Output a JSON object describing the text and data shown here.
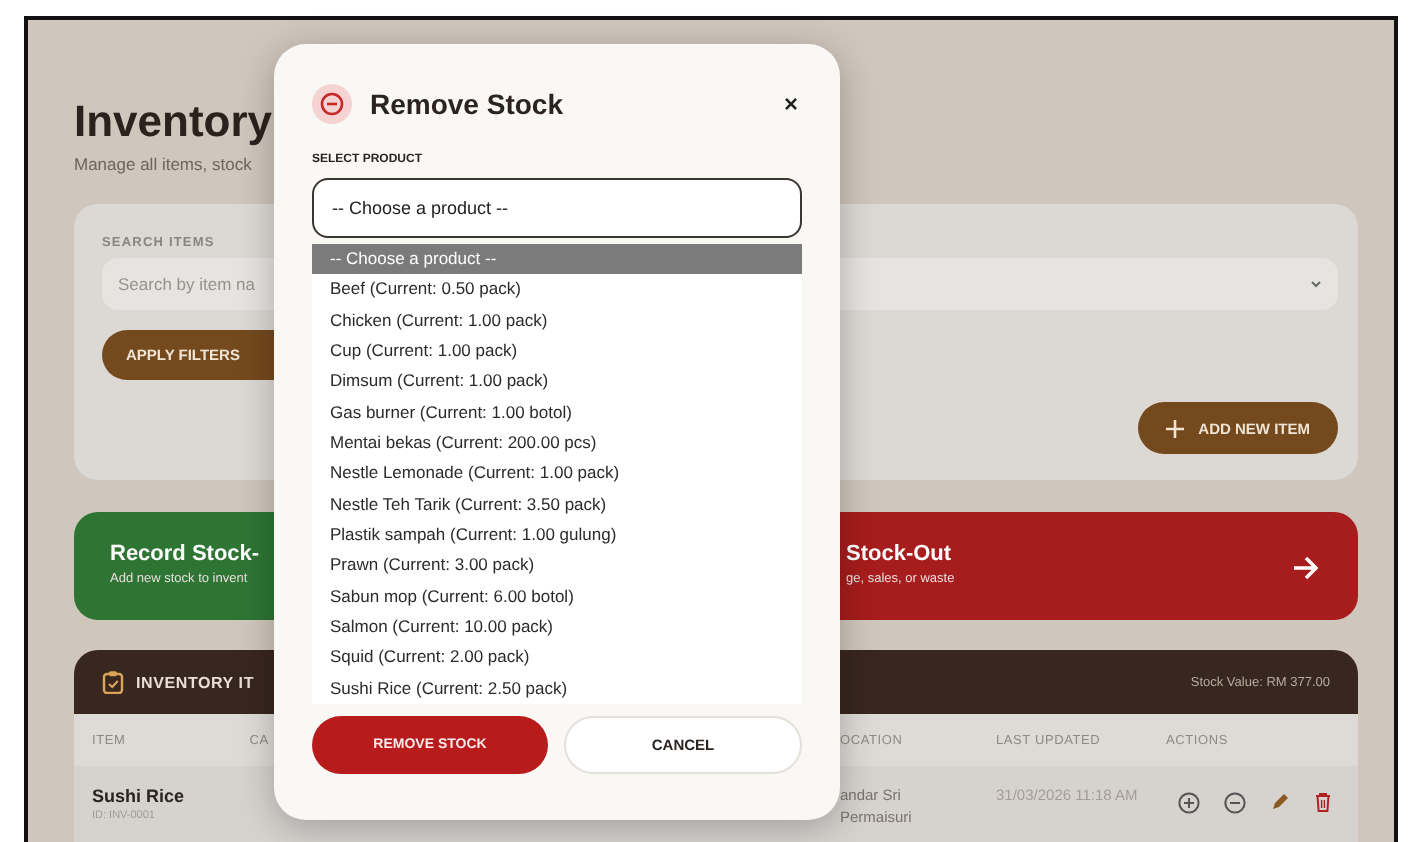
{
  "page": {
    "title": "Inventory",
    "subtitle": "Manage all items, stock"
  },
  "filters": {
    "search_label": "SEARCH ITEMS",
    "search_placeholder": "Search by item na",
    "apply_button": "APPLY FILTERS",
    "add_button": "ADD NEW ITEM"
  },
  "action_cards": [
    {
      "kind": "stock-in",
      "title": "Record Stock-",
      "subtitle": "Add new stock to invent"
    },
    {
      "kind": "stock-out",
      "title": "Stock-Out",
      "subtitle": "ge, sales, or waste"
    }
  ],
  "table": {
    "title": "INVENTORY IT",
    "stock_value": "Stock Value: RM 377.00",
    "left_columns": [
      "ITEM",
      "CA"
    ],
    "right_columns": [
      "OCATION",
      "LAST UPDATED",
      "ACTIONS"
    ],
    "rows": [
      {
        "item": "Sushi Rice",
        "id": "ID: INV-0001",
        "location": "andar Sri Permaisuri",
        "updated": "31/03/2026 11:18 AM"
      }
    ]
  },
  "modal": {
    "title": "Remove Stock",
    "close": "×",
    "field_label": "SELECT PRODUCT",
    "value": "-- Choose a product --",
    "options": [
      {
        "label": "-- Choose a product --",
        "selected": true
      },
      {
        "label": "Beef (Current: 0.50 pack)",
        "selected": false
      },
      {
        "label": "Chicken (Current: 1.00 pack)",
        "selected": false
      },
      {
        "label": "Cup (Current: 1.00 pack)",
        "selected": false
      },
      {
        "label": "Dimsum (Current: 1.00 pack)",
        "selected": false
      },
      {
        "label": "Gas burner (Current: 1.00 botol)",
        "selected": false
      },
      {
        "label": "Mentai bekas (Current: 200.00 pcs)",
        "selected": false
      },
      {
        "label": "Nestle Lemonade (Current: 1.00 pack)",
        "selected": false
      },
      {
        "label": "Nestle Teh Tarik (Current: 3.50 pack)",
        "selected": false
      },
      {
        "label": "Plastik sampah (Current: 1.00 gulung)",
        "selected": false
      },
      {
        "label": "Prawn (Current: 3.00 pack)",
        "selected": false
      },
      {
        "label": "Sabun mop (Current: 6.00 botol)",
        "selected": false
      },
      {
        "label": "Salmon (Current: 10.00 pack)",
        "selected": false
      },
      {
        "label": "Squid (Current: 2.00 pack)",
        "selected": false
      },
      {
        "label": "Sushi Rice (Current: 2.50 pack)",
        "selected": false
      }
    ],
    "confirm_button": "REMOVE STOCK",
    "cancel_button": "CANCEL"
  }
}
